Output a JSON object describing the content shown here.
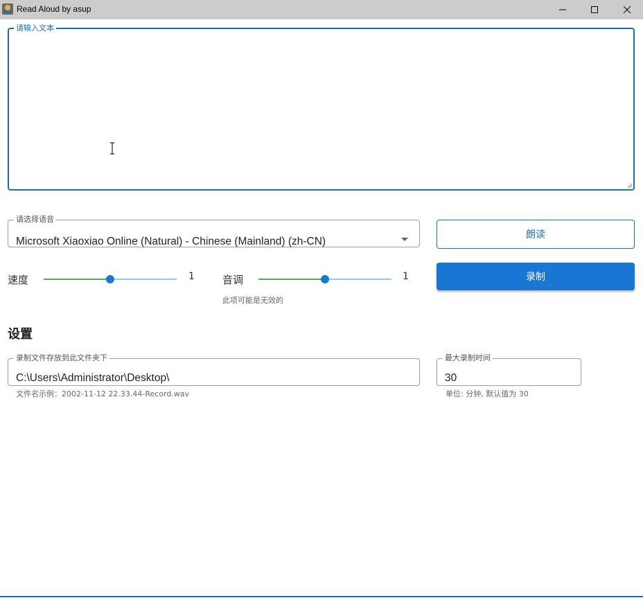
{
  "window": {
    "title": "Read Aloud by asup",
    "accent_color": "#1976d2"
  },
  "text_input": {
    "legend": "请输入文本",
    "value": ""
  },
  "voice": {
    "legend": "请选择语音",
    "selected": "Microsoft Xiaoxiao Online (Natural) - Chinese (Mainland) (zh-CN)"
  },
  "buttons": {
    "read_label": "朗读",
    "record_label": "录制"
  },
  "speed": {
    "label": "速度",
    "value": "1",
    "level": 0.5
  },
  "pitch": {
    "label": "音调",
    "value": "1",
    "level": 0.5,
    "helper": "此项可能是无效的"
  },
  "settings": {
    "title": "设置",
    "folder": {
      "legend": "录制文件存放到此文件夹下",
      "value": "C:\\Users\\Administrator\\Desktop\\",
      "helper": "文件名示例：2002-11-12 22.33.44-Record.wav"
    },
    "max_time": {
      "legend": "最大录制时间",
      "value": "30",
      "helper": "单位: 分钟, 默认值为 30"
    }
  },
  "icons": {
    "app": "app-icon",
    "minimize": "minimize-icon",
    "maximize": "maximize-icon",
    "close": "close-icon",
    "dropdown": "chevron-down-icon"
  }
}
